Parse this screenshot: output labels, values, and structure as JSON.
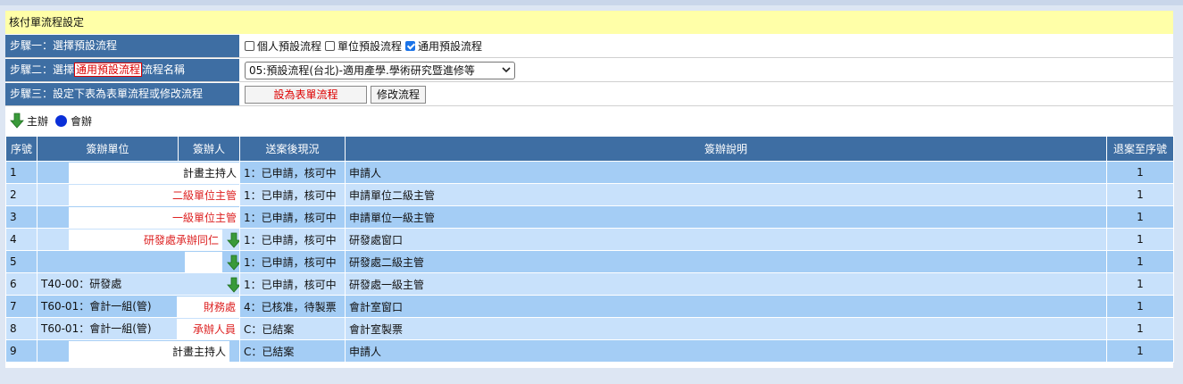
{
  "title": "核付單流程設定",
  "step1": {
    "label": "步驟一：選擇預設流程",
    "options": [
      {
        "label": "個人預設流程",
        "checked": false
      },
      {
        "label": "單位預設流程",
        "checked": false
      },
      {
        "label": "通用預設流程",
        "checked": true
      }
    ]
  },
  "step2": {
    "label_prefix": "步驟二：選擇",
    "label_highlight": "通用預設流程",
    "label_suffix": "流程名稱",
    "select_value": "05:預設流程(台北)-適用產學.學術研究暨進修等"
  },
  "step3": {
    "label": "步驟三：設定下表為表單流程或修改流程",
    "set_button": "設為表單流程",
    "modify_button": "修改流程"
  },
  "legend": {
    "main_label": "主辦",
    "co_label": "會辦"
  },
  "table": {
    "headers": [
      "序號",
      "簽辦單位",
      "簽辦人",
      "送案後現況",
      "簽辦說明",
      "退案至序號"
    ],
    "rows": [
      {
        "no": "1",
        "unit": "",
        "role": "計畫主持人",
        "status": "1：已申請，核可中",
        "desc": "申請人",
        "ret": "1"
      },
      {
        "no": "2",
        "unit": "",
        "role": "二級單位主管",
        "status": "1：已申請，核可中",
        "desc": "申請單位二級主管",
        "ret": "1"
      },
      {
        "no": "3",
        "unit": "",
        "role": "一級單位主管",
        "status": "1：已申請，核可中",
        "desc": "申請單位一級主管",
        "ret": "1"
      },
      {
        "no": "4",
        "unit": "",
        "role": "研發處承辦同仁",
        "status": "1：已申請，核可中",
        "desc": "研發處窗口",
        "ret": "1"
      },
      {
        "no": "5",
        "unit": "",
        "role": "",
        "status": "1：已申請，核可中",
        "desc": "研發處二級主管",
        "ret": "1"
      },
      {
        "no": "6",
        "unit": "T40-00：研發處",
        "role": "",
        "status": "1：已申請，核可中",
        "desc": "研發處一級主管",
        "ret": "1"
      },
      {
        "no": "7",
        "unit": "T60-01：會計一組(管)",
        "role": "財務處",
        "status": "4：已核准，待製票",
        "desc": "會計室窗口",
        "ret": "1"
      },
      {
        "no": "8",
        "unit": "T60-01：會計一組(管)",
        "role": "承辦人員",
        "status": "C：已結案",
        "desc": "會計室製票",
        "ret": "1"
      },
      {
        "no": "9",
        "unit": "",
        "role": "計畫主持人",
        "status": "C：已結案",
        "desc": "申請人",
        "ret": "1"
      }
    ]
  },
  "colors": {
    "header_blue": "#3e6ea3",
    "row_dark": "#a4cdf5",
    "row_light": "#c8e1fb",
    "title_yellow": "#ffffa8",
    "role_red": "#d22"
  }
}
